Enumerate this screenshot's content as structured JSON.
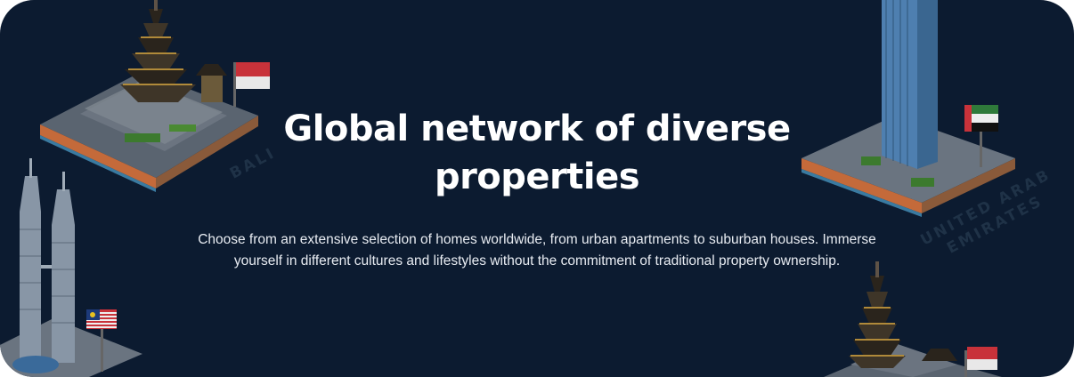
{
  "banner": {
    "title_line1": "Global network of diverse",
    "title_line2": "properties",
    "description_line1": "Choose from an extensive selection of homes worldwide, from urban apartments to suburban houses. Immerse",
    "description_line2": "yourself in different cultures and lifestyles without the commitment of traditional property ownership."
  },
  "illustrations": {
    "bali": {
      "label": "BALI",
      "icon": "bali-temple-icon"
    },
    "uae": {
      "label_line1": "UNITED ARAB",
      "label_line2": "EMIRATES",
      "icon": "uae-tower-icon"
    },
    "malaysia": {
      "icon": "malaysia-twin-towers-icon"
    },
    "bali_bottom": {
      "icon": "bali-temple-icon"
    }
  },
  "colors": {
    "background": "#0c1b30",
    "title": "#ffffff",
    "description": "#e8ecf2",
    "label": "#1f3247"
  }
}
